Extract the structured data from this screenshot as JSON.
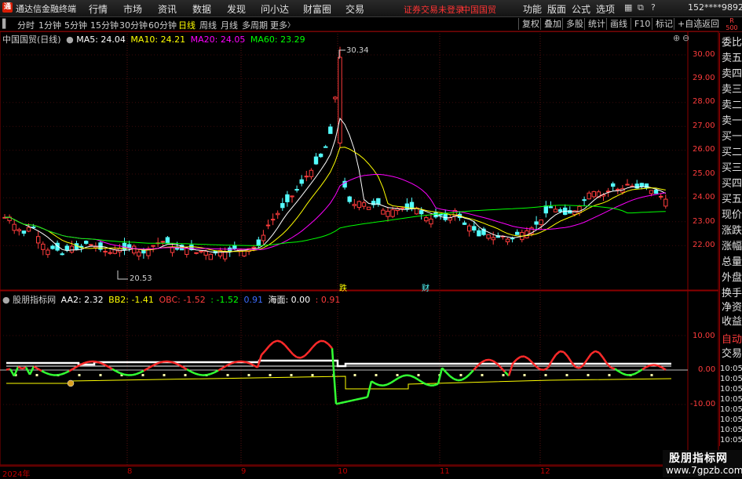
{
  "app": {
    "logo": "通",
    "title": "通达信金融终端"
  },
  "menu": [
    {
      "label": "行情"
    },
    {
      "label": "市场"
    },
    {
      "label": "资讯"
    },
    {
      "label": "数据"
    },
    {
      "label": "发现"
    },
    {
      "label": "问小达"
    },
    {
      "label": "财富圈"
    },
    {
      "label": "交易"
    }
  ],
  "notice": {
    "login": "证券交易未登录",
    "stock": "中国国贸"
  },
  "menu_right": [
    {
      "label": "功能"
    },
    {
      "label": "版面"
    },
    {
      "label": "公式"
    },
    {
      "label": "选项"
    }
  ],
  "account": "152****9892",
  "periods": [
    {
      "label": "分时",
      "active": false
    },
    {
      "label": "1分钟",
      "active": false
    },
    {
      "label": "5分钟",
      "active": false
    },
    {
      "label": "15分钟",
      "active": false
    },
    {
      "label": "30分钟",
      "active": false
    },
    {
      "label": "60分钟",
      "active": false
    },
    {
      "label": "日线",
      "active": true
    },
    {
      "label": "周线",
      "active": false
    },
    {
      "label": "月线",
      "active": false
    },
    {
      "label": "多周期",
      "active": false
    },
    {
      "label": "更多",
      "active": false
    }
  ],
  "tools": [
    {
      "label": "复权"
    },
    {
      "label": "叠加"
    },
    {
      "label": "多股"
    },
    {
      "label": "统计"
    },
    {
      "label": "画线"
    },
    {
      "label": "F10"
    },
    {
      "label": "标记"
    },
    {
      "label": "+自选"
    },
    {
      "label": "返回"
    }
  ],
  "main_legend": {
    "name": "中国国贸(日线)",
    "ma5": "MA5: 24.04",
    "ma10": "MA10: 24.21",
    "ma20": "MA20: 24.05",
    "ma60": "MA60: 23.29"
  },
  "ind_legend": {
    "name": "股朋指标网",
    "aa2": "AA2: 2.32",
    "bb2": "BB2: -1.41",
    "obc": "OBC: -1.52",
    "v4": ": -1.52",
    "v5": "0.91",
    "v6": "海面: 0.00",
    "v7": ": 0.91"
  },
  "colors": {
    "up": "#ff3c3c",
    "down": "#54ffff",
    "ma5": "#ffffff",
    "ma10": "#ffff00",
    "ma20": "#ff00ff",
    "ma60": "#00ff00"
  },
  "sidebar": [
    {
      "label": "委比"
    },
    {
      "label": "卖五"
    },
    {
      "label": "卖四"
    },
    {
      "label": "卖三"
    },
    {
      "label": "卖二"
    },
    {
      "label": "卖一"
    },
    {
      "label": "买一"
    },
    {
      "label": "买二"
    },
    {
      "label": "买三"
    },
    {
      "label": "买四"
    },
    {
      "label": "买五"
    },
    {
      "label": "现价"
    },
    {
      "label": "涨跌"
    },
    {
      "label": "涨幅"
    },
    {
      "label": "总量"
    },
    {
      "label": "外盘"
    },
    {
      "label": "换手"
    },
    {
      "label": "净资"
    },
    {
      "label": "收益"
    }
  ],
  "sidebar_bottom": {
    "auto": "自动",
    "trade": "交易"
  },
  "sidebar_prices": [
    "10:05",
    "10:05",
    "10:05",
    "10:05",
    "10:05",
    "10:05",
    "10:05",
    "10:05",
    "10:05",
    "10:05"
  ],
  "sidebar_top": {
    "r": "R",
    "num": "500"
  },
  "price_axis": [
    "30.00",
    "29.00",
    "28.00",
    "27.00",
    "26.00",
    "25.00",
    "24.00",
    "23.00",
    "22.00"
  ],
  "ind_axis": [
    "10.00",
    "0.00",
    "-10.00"
  ],
  "x_axis": [
    "2024年",
    "8",
    "9",
    "10",
    "11",
    "12"
  ],
  "annotations": {
    "high": "30.34",
    "low": "20.53",
    "mark1": "跌",
    "mark2": "财"
  },
  "watermark": {
    "line1": "股朋指标网",
    "line2": "www.7gpzb.com"
  }
}
